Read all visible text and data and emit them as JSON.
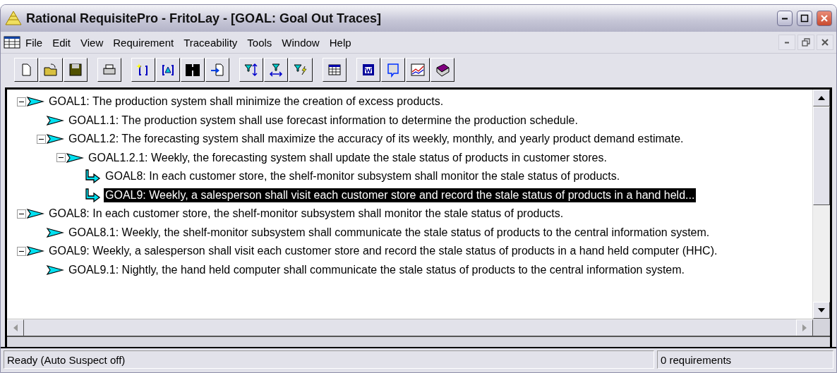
{
  "window": {
    "title": "Rational RequisitePro - FritoLay - [GOAL: Goal Out Traces]"
  },
  "menu": [
    "File",
    "Edit",
    "View",
    "Requirement",
    "Traceability",
    "Tools",
    "Window",
    "Help"
  ],
  "tree": [
    {
      "kind": "requirement",
      "text": "GOAL1: The production system shall minimize the creation of excess products.",
      "expanded": true,
      "selected": false,
      "children": [
        {
          "kind": "requirement",
          "text": "GOAL1.1: The production system shall use forecast information to determine the production schedule.",
          "selected": false
        },
        {
          "kind": "requirement",
          "text": "GOAL1.2: The forecasting system shall maximize the accuracy of its weekly, monthly, and yearly product demand estimate.",
          "expanded": true,
          "selected": false,
          "children": [
            {
              "kind": "requirement",
              "text": "GOAL1.2.1: Weekly, the forecasting system shall update the stale status of products in customer stores.",
              "expanded": true,
              "selected": false,
              "children": [
                {
                  "kind": "trace",
                  "text": "GOAL8: In each customer store, the shelf-monitor subsystem shall monitor the stale status of products.",
                  "selected": false
                },
                {
                  "kind": "trace",
                  "text": "GOAL9: Weekly, a salesperson shall visit each customer store and record the stale status of products in a hand held...",
                  "selected": true
                }
              ]
            }
          ]
        }
      ]
    },
    {
      "kind": "requirement",
      "text": "GOAL8: In each customer store, the shelf-monitor subsystem shall monitor the stale status of products.",
      "expanded": true,
      "selected": false,
      "children": [
        {
          "kind": "requirement",
          "text": "GOAL8.1: Weekly, the shelf-monitor subsystem shall communicate the stale status of products to the central information system.",
          "selected": false
        }
      ]
    },
    {
      "kind": "requirement",
      "text": "GOAL9: Weekly, a salesperson shall visit each customer store and record the stale status of products in a hand held computer (HHC).",
      "expanded": true,
      "selected": false,
      "children": [
        {
          "kind": "requirement",
          "text": "GOAL9.1: Nightly, the hand held computer shall communicate the stale status of products to the central information system.",
          "selected": false
        }
      ]
    }
  ],
  "status_bar": {
    "message": "Ready (Auto Suspect off)",
    "count": "0 requirements"
  }
}
